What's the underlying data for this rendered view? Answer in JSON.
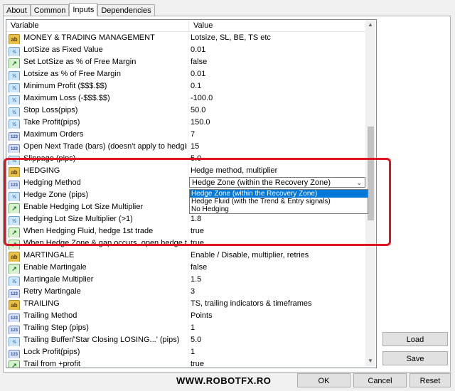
{
  "tabs": [
    {
      "label": "About",
      "active": false
    },
    {
      "label": "Common",
      "active": false
    },
    {
      "label": "Inputs",
      "active": true
    },
    {
      "label": "Dependencies",
      "active": false
    }
  ],
  "grid": {
    "header": {
      "variable": "Variable",
      "value": "Value"
    },
    "rows": [
      {
        "icon": "ab",
        "name": "MONEY & TRADING MANAGEMENT",
        "value": "Lotsize, SL, BE, TS etc"
      },
      {
        "icon": "v",
        "name": "LotSize as Fixed Value",
        "value": "0.01"
      },
      {
        "icon": "b",
        "name": "Set LotSize as % of Free Margin",
        "value": "false"
      },
      {
        "icon": "v",
        "name": "Lotsize as % of Free Margin",
        "value": "0.01"
      },
      {
        "icon": "v",
        "name": "Minimum Profit ($$$.$$)",
        "value": "0.1"
      },
      {
        "icon": "v",
        "name": "Maximum Loss (-$$$.$$)",
        "value": "-100.0"
      },
      {
        "icon": "v",
        "name": "Stop Loss(pips)",
        "value": "50.0"
      },
      {
        "icon": "v",
        "name": "Take Profit(pips)",
        "value": "150.0"
      },
      {
        "icon": "n",
        "name": "Maximum Orders",
        "value": "7"
      },
      {
        "icon": "n",
        "name": "Open Next Trade (bars) (doesn't apply to hedging trad...",
        "value": "15"
      },
      {
        "icon": "v",
        "name": "Slippage (pips)",
        "value": "5.0"
      },
      {
        "icon": "ab",
        "name": "HEDGING",
        "value": "Hedge method, multiplier"
      },
      {
        "icon": "n",
        "name": "Hedging Method",
        "value": "Hedge Zone (within the Recovery Zone)"
      },
      {
        "icon": "v",
        "name": "Hedge Zone (pips)",
        "value": ""
      },
      {
        "icon": "b",
        "name": "Enable Hedging Lot Size Multiplier",
        "value": ""
      },
      {
        "icon": "v",
        "name": "Hedging Lot Size Multiplier (>1)",
        "value": "1.8"
      },
      {
        "icon": "b",
        "name": "When Hedging Fluid, hedge 1st trade",
        "value": "true"
      },
      {
        "icon": "b",
        "name": "When Hedge Zone & gap occurs, open hedge trade",
        "value": "true"
      },
      {
        "icon": "ab",
        "name": "MARTINGALE",
        "value": "Enable / Disable, multiplier, retries"
      },
      {
        "icon": "b",
        "name": "Enable Martingale",
        "value": "false"
      },
      {
        "icon": "v",
        "name": "Martingale Multiplier",
        "value": "1.5"
      },
      {
        "icon": "n",
        "name": "Retry Martingale",
        "value": "3"
      },
      {
        "icon": "ab",
        "name": "TRAILING",
        "value": "TS, trailing indicators & timeframes"
      },
      {
        "icon": "n",
        "name": "Trailing Method",
        "value": "Points"
      },
      {
        "icon": "n",
        "name": "Trailing Step (pips)",
        "value": "1"
      },
      {
        "icon": "v",
        "name": "Trailing Buffer/'Star Closing LOSING...' (pips)",
        "value": "5.0"
      },
      {
        "icon": "n",
        "name": "Lock Profit(pips)",
        "value": "1"
      },
      {
        "icon": "b",
        "name": "Trail from +profit",
        "value": "true"
      }
    ]
  },
  "dropdown": {
    "options": [
      "Hedge Zone (within the Recovery Zone)",
      "Hedge Fluid (with the Trend & Entry signals)",
      "No Hedging"
    ],
    "selected": 0
  },
  "buttons": {
    "load": "Load",
    "save": "Save",
    "ok": "OK",
    "cancel": "Cancel",
    "reset": "Reset"
  },
  "watermark": "WWW.ROBOTFX.RO",
  "icon_glyphs": {
    "ab": "ab",
    "v": "½",
    "b": "↗",
    "n": "123"
  },
  "colors": {
    "highlight": "#e0141e",
    "selection": "#0078d7"
  }
}
